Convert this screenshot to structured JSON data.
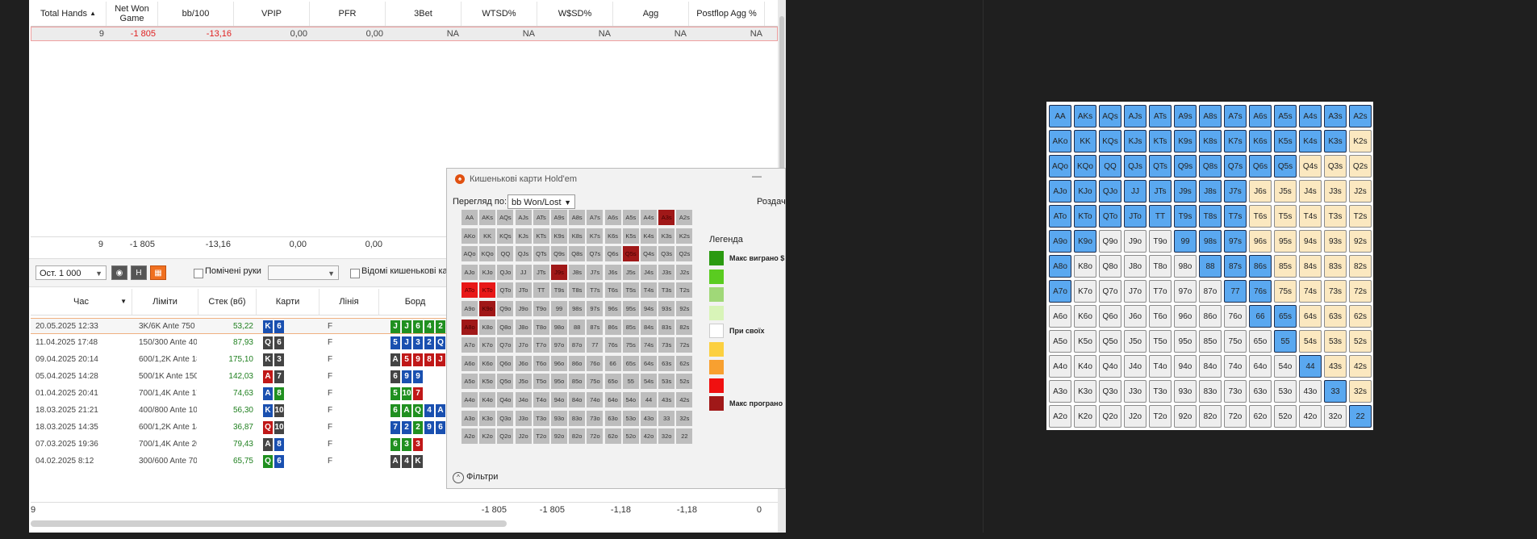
{
  "stats_table": {
    "columns": [
      "Total Hands",
      "Net Won Game",
      "bb/100",
      "VPIP",
      "PFR",
      "3Bet",
      "WTSD%",
      "W$SD%",
      "Agg",
      "Postflop Agg %"
    ],
    "row": [
      "9",
      "-1 805",
      "-13,16",
      "0,00",
      "0,00",
      "NA",
      "NA",
      "NA",
      "NA",
      "NA"
    ],
    "totals": [
      "9",
      "-1 805",
      "-13,16",
      "0,00",
      "0,00"
    ]
  },
  "toolbar": {
    "last_hands": "Ост. 1 000",
    "marked_hands_label": "Помічені руки",
    "known_cards_label": "Відомі кишенькові кар"
  },
  "hands_table": {
    "columns": [
      "Час",
      "Ліміти",
      "Стек (вб)",
      "Карти",
      "Лінія",
      "Борд"
    ],
    "rows": [
      {
        "time": "20.05.2025 12:33",
        "limit": "3K/6K Ante 750",
        "stack": "53,22",
        "cards": [
          [
            "K",
            "#1a50b0"
          ],
          [
            "6",
            "#1a50b0"
          ]
        ],
        "line": "F",
        "board": [
          [
            "J",
            "#209020"
          ],
          [
            "J",
            "#209020"
          ],
          [
            "6",
            "#209020"
          ],
          [
            "4",
            "#209020"
          ],
          [
            "2",
            "#209020"
          ]
        ]
      },
      {
        "time": "11.04.2025 17:48",
        "limit": "150/300 Ante 40",
        "stack": "87,93",
        "cards": [
          [
            "Q",
            "#444444"
          ],
          [
            "6",
            "#444444"
          ]
        ],
        "line": "F",
        "board": [
          [
            "5",
            "#1a50b0"
          ],
          [
            "J",
            "#1a50b0"
          ],
          [
            "3",
            "#1a50b0"
          ],
          [
            "2",
            "#1a50b0"
          ],
          [
            "Q",
            "#1a50b0"
          ]
        ]
      },
      {
        "time": "09.04.2025 20:14",
        "limit": "600/1,2K Ante 18",
        "stack": "175,10",
        "cards": [
          [
            "K",
            "#444444"
          ],
          [
            "3",
            "#444444"
          ]
        ],
        "line": "F",
        "board": [
          [
            "A",
            "#444444"
          ],
          [
            "5",
            "#c01818"
          ],
          [
            "9",
            "#c01818"
          ],
          [
            "8",
            "#c01818"
          ],
          [
            "J",
            "#c01818"
          ]
        ]
      },
      {
        "time": "05.04.2025 14:28",
        "limit": "500/1K Ante 150",
        "stack": "142,03",
        "cards": [
          [
            "A",
            "#c01818"
          ],
          [
            "7",
            "#444444"
          ]
        ],
        "line": "F",
        "board": [
          [
            "6",
            "#444444"
          ],
          [
            "9",
            "#1a50b0"
          ],
          [
            "9",
            "#1a50b0"
          ]
        ]
      },
      {
        "time": "01.04.2025 20:41",
        "limit": "700/1,4K Ante 17",
        "stack": "74,63",
        "cards": [
          [
            "A",
            "#1a50b0"
          ],
          [
            "8",
            "#209020"
          ]
        ],
        "line": "F",
        "board": [
          [
            "5",
            "#209020"
          ],
          [
            "10",
            "#209020"
          ],
          [
            "7",
            "#c01818"
          ]
        ]
      },
      {
        "time": "18.03.2025 21:21",
        "limit": "400/800 Ante 10",
        "stack": "56,30",
        "cards": [
          [
            "K",
            "#1a50b0"
          ],
          [
            "10",
            "#444444"
          ]
        ],
        "line": "F",
        "board": [
          [
            "6",
            "#209020"
          ],
          [
            "A",
            "#209020"
          ],
          [
            "Q",
            "#209020"
          ],
          [
            "4",
            "#1a50b0"
          ],
          [
            "A",
            "#1a50b0"
          ]
        ]
      },
      {
        "time": "18.03.2025 14:35",
        "limit": "600/1,2K Ante 14",
        "stack": "36,87",
        "cards": [
          [
            "Q",
            "#c01818"
          ],
          [
            "10",
            "#444444"
          ]
        ],
        "line": "F",
        "board": [
          [
            "7",
            "#1a50b0"
          ],
          [
            "2",
            "#1a50b0"
          ],
          [
            "2",
            "#209020"
          ],
          [
            "9",
            "#1a50b0"
          ],
          [
            "6",
            "#1a50b0"
          ]
        ]
      },
      {
        "time": "07.03.2025 19:36",
        "limit": "700/1,4K Ante 20",
        "stack": "79,43",
        "cards": [
          [
            "A",
            "#444444"
          ],
          [
            "8",
            "#1a50b0"
          ]
        ],
        "line": "F",
        "board": [
          [
            "6",
            "#209020"
          ],
          [
            "3",
            "#209020"
          ],
          [
            "3",
            "#c01818"
          ]
        ]
      },
      {
        "time": "04.02.2025 8:12",
        "limit": "300/600 Ante 70",
        "stack": "65,75",
        "cards": [
          [
            "Q",
            "#209020"
          ],
          [
            "6",
            "#1a50b0"
          ]
        ],
        "line": "F",
        "board": [
          [
            "A",
            "#444444"
          ],
          [
            "4",
            "#444444"
          ],
          [
            "K",
            "#444444"
          ]
        ]
      }
    ],
    "totals": [
      "9",
      "-1 805",
      "-1 805",
      "-1,18",
      "-1,18",
      "0"
    ]
  },
  "popup": {
    "title": "Кишенькові карти Hold'em",
    "view_by_label": "Перегляд по:",
    "view_by_value": "bb Won/Lost",
    "right_label": "Роздач",
    "legend_title": "Легенда",
    "legend": [
      {
        "color": "#2a9a10",
        "label": "Макс виграно $"
      },
      {
        "color": "#5acc20",
        "label": ""
      },
      {
        "color": "#a0d878",
        "label": ""
      },
      {
        "color": "#d8f4b8",
        "label": ""
      },
      {
        "color": "#ffffff",
        "label": "При своїх"
      },
      {
        "color": "#fcd040",
        "label": ""
      },
      {
        "color": "#f8a030",
        "label": ""
      },
      {
        "color": "#f01010",
        "label": ""
      },
      {
        "color": "#a01818",
        "label": "Макс програно"
      }
    ],
    "filters_label": "Фільтри",
    "highlight": {
      "J9s": "dred",
      "A3s": "dred",
      "Q5s": "dred",
      "K9o": "dred",
      "ATo": "red",
      "KTo": "red",
      "A8o": "dred"
    }
  },
  "range_grid": {
    "blue": [
      "AA",
      "AKs",
      "AQs",
      "AJs",
      "ATs",
      "A9s",
      "A8s",
      "A7s",
      "A6s",
      "A5s",
      "A4s",
      "A3s",
      "A2s",
      "AKo",
      "KK",
      "KQs",
      "KJs",
      "KTs",
      "K9s",
      "K8s",
      "K7s",
      "K6s",
      "K5s",
      "K4s",
      "K3s",
      "AQo",
      "KQo",
      "QQ",
      "QJs",
      "QTs",
      "Q9s",
      "Q8s",
      "Q7s",
      "Q6s",
      "Q5s",
      "AJo",
      "KJo",
      "QJo",
      "JJ",
      "JTs",
      "J9s",
      "J8s",
      "J7s",
      "ATo",
      "KTo",
      "QTo",
      "JTo",
      "TT",
      "T9s",
      "T8s",
      "T7s",
      "A9o",
      "K9o",
      "99",
      "98s",
      "97s",
      "A8o",
      "88",
      "87s",
      "86s",
      "A7o",
      "77",
      "76s",
      "66",
      "65s",
      "55",
      "44",
      "33",
      "22"
    ],
    "yellow": [
      "K2s",
      "Q4s",
      "Q3s",
      "Q2s",
      "J6s",
      "J5s",
      "J4s",
      "J3s",
      "J2s",
      "T6s",
      "T5s",
      "T4s",
      "T3s",
      "T2s",
      "96s",
      "95s",
      "94s",
      "93s",
      "92s",
      "85s",
      "84s",
      "83s",
      "82s",
      "75s",
      "74s",
      "73s",
      "72s",
      "64s",
      "63s",
      "62s",
      "54s",
      "53s",
      "52s",
      "43s",
      "42s",
      "32s"
    ]
  }
}
